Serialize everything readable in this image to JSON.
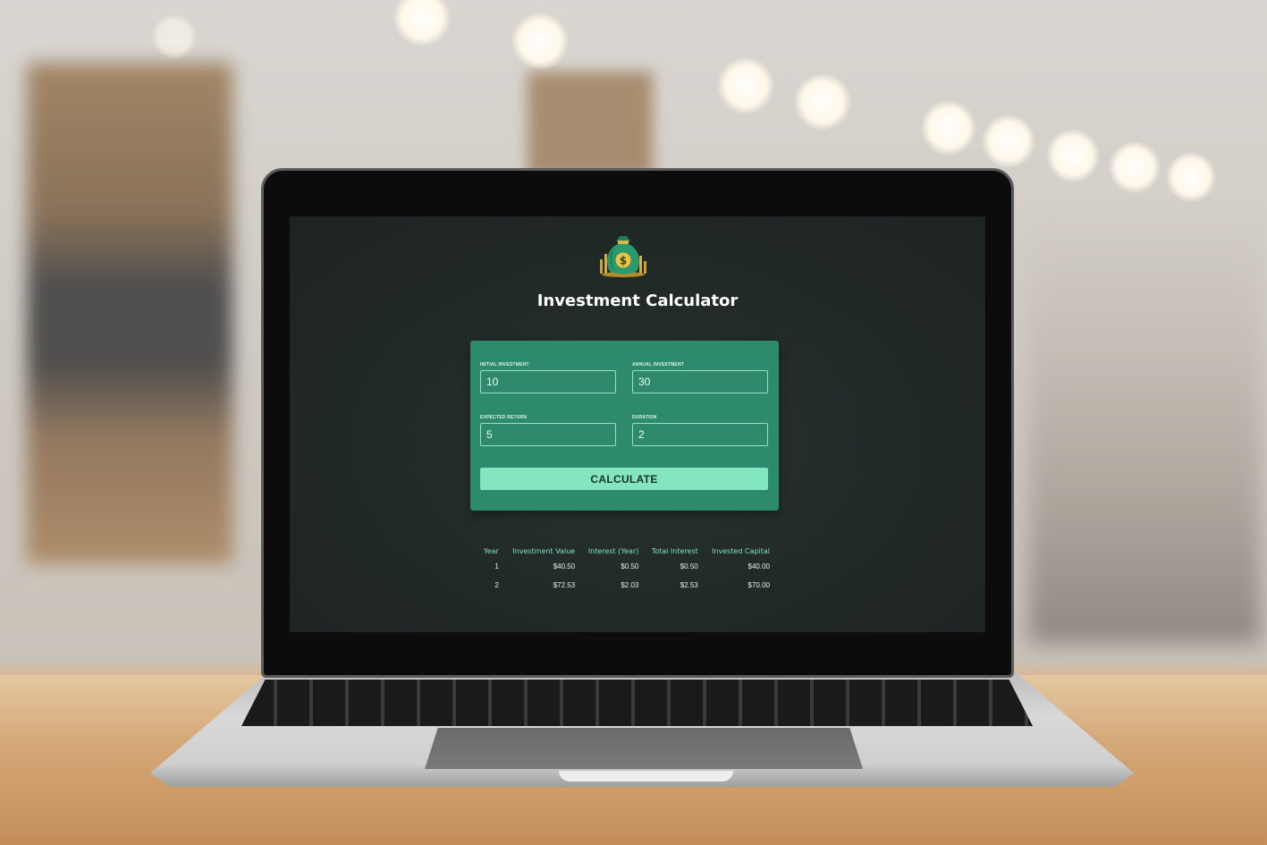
{
  "app": {
    "title": "Investment Calculator",
    "logo_icon": "money-bag-icon"
  },
  "form": {
    "initial_investment": {
      "label": "Initial Investment",
      "value": "10"
    },
    "annual_investment": {
      "label": "Annual Investment",
      "value": "30"
    },
    "expected_return": {
      "label": "Expected Return",
      "value": "5"
    },
    "duration": {
      "label": "Duration",
      "value": "2"
    },
    "calculate_label": "CALCULATE"
  },
  "results": {
    "headers": [
      "Year",
      "Investment Value",
      "Interest (Year)",
      "Total Interest",
      "Invested Capital"
    ],
    "rows": [
      [
        "1",
        "$40.50",
        "$0.50",
        "$0.50",
        "$40.00"
      ],
      [
        "2",
        "$72.53",
        "$2.03",
        "$2.53",
        "$70.00"
      ]
    ]
  },
  "colors": {
    "screen_bg": "#212927",
    "card_bg": "#2e8a6c",
    "button_bg": "#84e6bf",
    "header_text": "#7fe3bd"
  }
}
